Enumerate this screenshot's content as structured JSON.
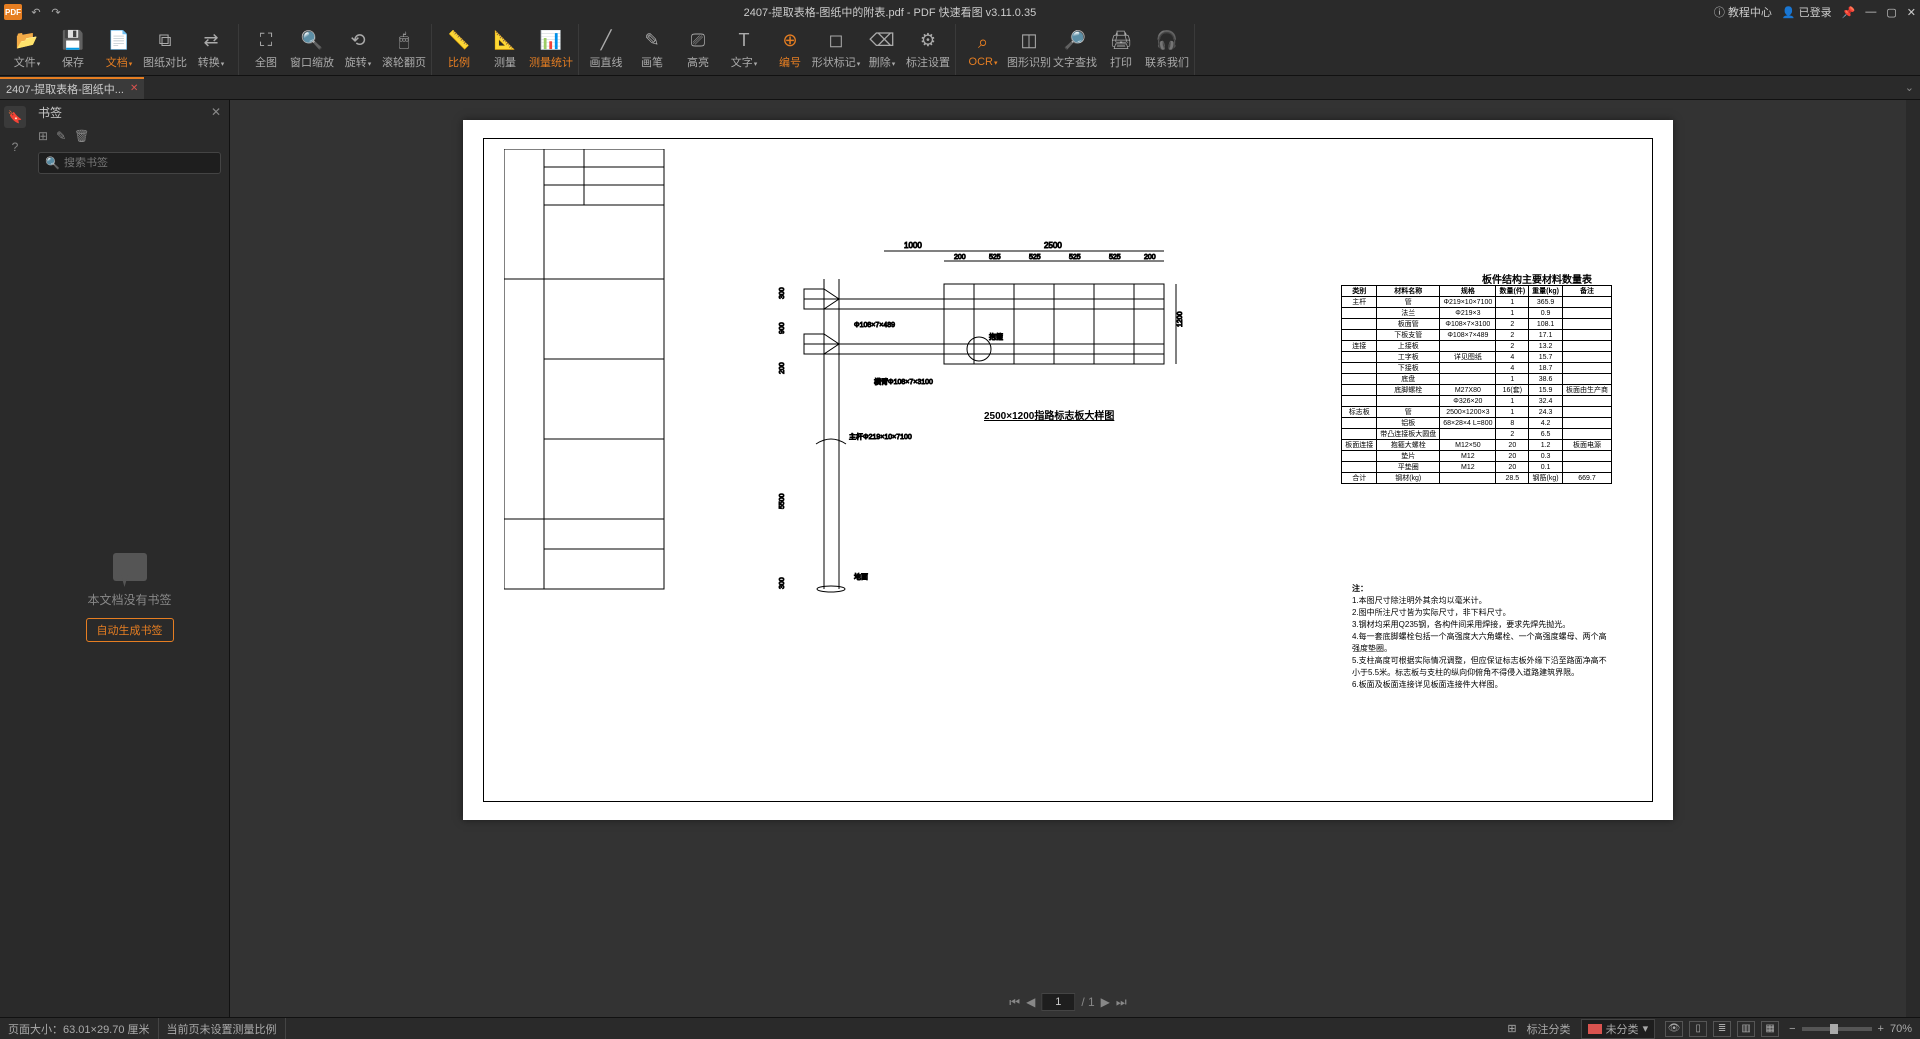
{
  "title_bar": {
    "doc_title": "2407-提取表格-图纸中的附表.pdf - PDF 快速看图 v3.11.0.35",
    "help_center": "教程中心",
    "login": "已登录"
  },
  "toolbar": {
    "file": "文件",
    "save": "保存",
    "doc": "文档",
    "compare": "图纸对比",
    "convert": "转换",
    "fullscreen": "全图",
    "window_zoom": "窗口缩放",
    "rotate": "旋转",
    "scroll": "滚轮翻页",
    "scale": "比例",
    "measure": "测量",
    "measure_stats": "测量统计",
    "line": "画直线",
    "pen": "画笔",
    "highlight": "高亮",
    "text": "文字",
    "number": "编号",
    "shape_mark": "形状标记",
    "delete": "删除",
    "mark_setting": "标注设置",
    "ocr": "OCR",
    "graphic_rec": "图形识别",
    "text_search": "文字查找",
    "print": "打印",
    "contact": "联系我们"
  },
  "tab": {
    "label": "2407-提取表格-图纸中..."
  },
  "sidebar": {
    "title": "书签",
    "search_placeholder": "搜索书签",
    "empty_msg": "本文档没有书签",
    "auto_btn": "自动生成书签"
  },
  "drawing": {
    "main_label": "2500×1200指路标志板大样图",
    "table_title": "板件结构主要材料数量表",
    "notes_title": "注：",
    "notes": [
      "1.本图尺寸除注明外其余均以毫米计。",
      "2.图中所注尺寸皆为实际尺寸，非下料尺寸。",
      "3.钢材均采用Q235钢，各构件间采用焊接，要求先焊先抛光。",
      "4.每一套底脚螺栓包括一个高强度大六角螺栓、一个高强度螺母、两个高强度垫圈。",
      "5.支柱高度可根据实际情况调整，但应保证标志板外缘下沿至路面净高不小于5.5米。标志板与支柱的纵向仰俯角不得侵入道路建筑界限。",
      "6.板面及板面连接详见板面连接件大样图。"
    ],
    "table_headers": [
      "类别",
      "材料名称",
      "规格",
      "数量(件)",
      "重量(kg)",
      "备注"
    ],
    "table_rows": [
      [
        "主杆",
        "管",
        "Φ219×10×7100",
        "1",
        "365.9",
        ""
      ],
      [
        "",
        "法兰",
        "Φ219×3",
        "1",
        "0.9",
        ""
      ],
      [
        "",
        "板面管",
        "Φ108×7×3100",
        "2",
        "108.1",
        ""
      ],
      [
        "",
        "下板支管",
        "Φ108×7×489",
        "2",
        "17.1",
        ""
      ],
      [
        "连接",
        "上接板",
        "",
        "2",
        "13.2",
        ""
      ],
      [
        "",
        "工字板",
        "详见图纸",
        "4",
        "15.7",
        ""
      ],
      [
        "",
        "下接板",
        "",
        "4",
        "18.7",
        ""
      ],
      [
        "",
        "底盘",
        "",
        "1",
        "38.6",
        ""
      ],
      [
        "",
        "底脚螺栓",
        "M27X80",
        "16(套)",
        "15.9",
        "板面由生产商"
      ],
      [
        "",
        "",
        "Φ326×20",
        "1",
        "32.4",
        ""
      ],
      [
        "标志板",
        "管",
        "2500×1200×3",
        "1",
        "24.3",
        ""
      ],
      [
        "",
        "铝板",
        "68×28×4 L=800",
        "8",
        "4.2",
        ""
      ],
      [
        "",
        "带凸连接板大圆盘",
        "",
        "2",
        "6.5",
        ""
      ],
      [
        "板面连接",
        "抱箍大螺栓",
        "M12×50",
        "20",
        "1.2",
        "板面电源"
      ],
      [
        "",
        "垫片",
        "M12",
        "20",
        "0.3",
        ""
      ],
      [
        "",
        "平垫圈",
        "M12",
        "20",
        "0.1",
        ""
      ],
      [
        "合计",
        "钢材(kg)",
        "",
        "28.5",
        "钢筋(kg)",
        "669.7"
      ]
    ]
  },
  "status": {
    "page_size": "页面大小：63.01×29.70 厘米",
    "scale_msg": "当前页未设置测量比例",
    "page_current": "1",
    "page_total": "/  1",
    "mark_class": "标注分类",
    "unclassified": "未分类",
    "zoom": "70%"
  }
}
